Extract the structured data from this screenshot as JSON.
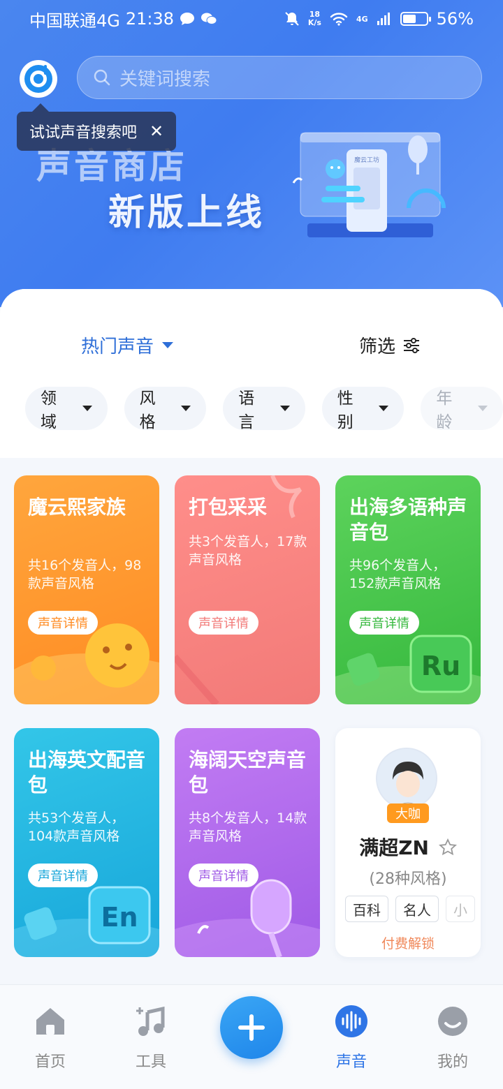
{
  "status_bar": {
    "carrier": "中国联通4G",
    "time": "21:38",
    "speed_value": "18",
    "speed_unit": "K/s",
    "network": "4G",
    "battery_percent": "56%",
    "battery_level": 0.56
  },
  "header": {
    "search_placeholder": "关键词搜索",
    "tooltip_text": "试试声音搜索吧",
    "banner_line1": "声音商店",
    "banner_line2": "新版上线",
    "banner_art_label": "魔云工坊"
  },
  "filters": {
    "sort_label": "热门声音",
    "filter_label": "筛选",
    "chips": [
      "领域",
      "风格",
      "语言",
      "性别",
      "年龄"
    ]
  },
  "cards": [
    {
      "title": "魔云熙家族",
      "desc": "共16个发音人，98款声音风格",
      "button": "声音详情",
      "button_color": "#ff8b22"
    },
    {
      "title": "打包采采",
      "desc": "共3个发音人，17款声音风格",
      "button": "声音详情",
      "button_color": "#f27a78"
    },
    {
      "title": "出海多语种声音包",
      "desc": "共96个发音人，152款声音风格",
      "button": "声音详情",
      "button_color": "#35b83d",
      "badge": "Ru"
    },
    {
      "title": "出海英文配音包",
      "desc": "共53个发音人，104款声音风格",
      "button": "声音详情",
      "button_color": "#17a6da",
      "badge": "En"
    },
    {
      "title": "海阔天空声音包",
      "desc": "共8个发音人，14款声音风格",
      "button": "声音详情",
      "button_color": "#9f5ae6"
    }
  ],
  "person_card": {
    "badge": "大咖",
    "name": "满超ZN",
    "styles": "(28种风格)",
    "tags": [
      "百科",
      "名人",
      "小"
    ],
    "unlock": "付费解锁"
  },
  "bottom_nav": {
    "home": "首页",
    "tools": "工具",
    "sound": "声音",
    "mine": "我的",
    "accent": "#2f75e6"
  }
}
